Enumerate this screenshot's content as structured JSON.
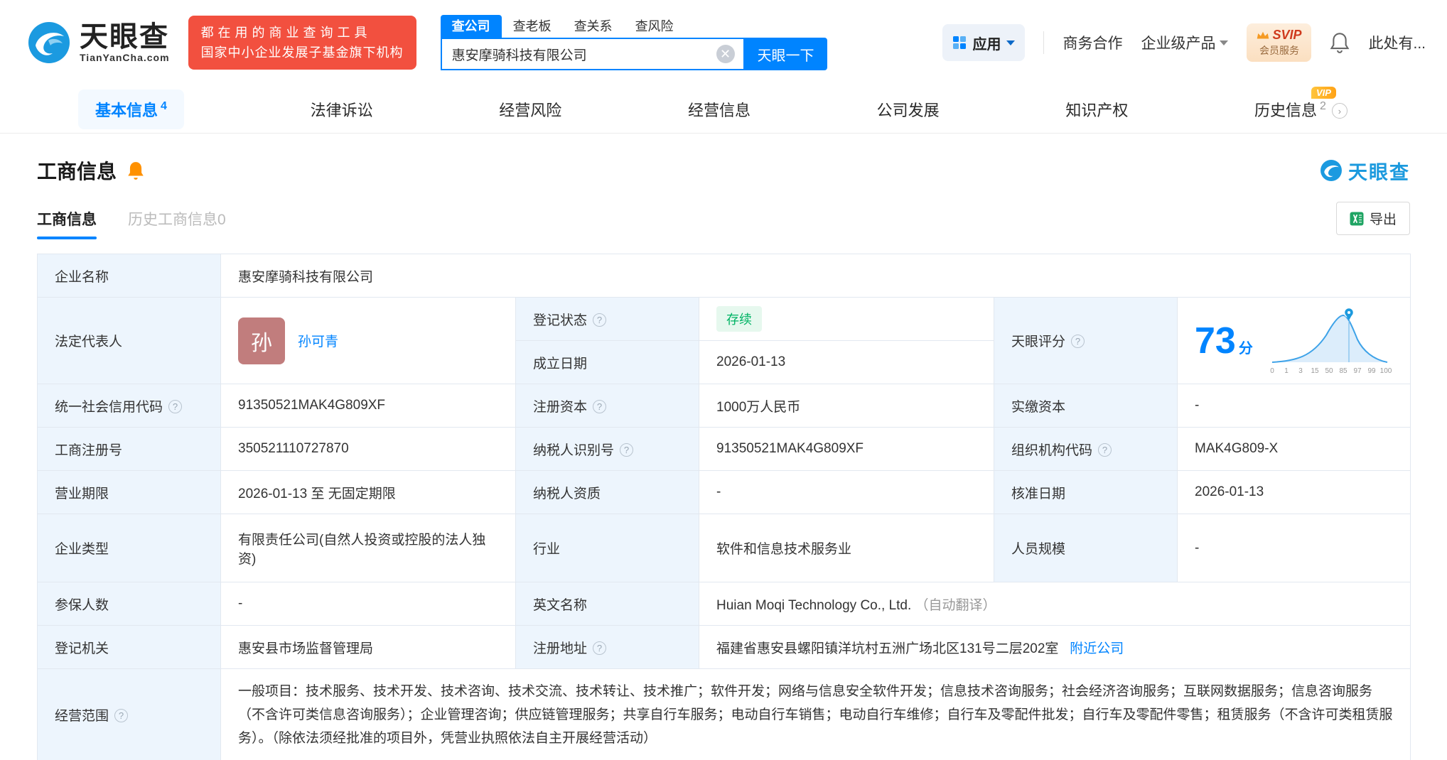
{
  "header": {
    "brand": {
      "name": "天眼查",
      "domain": "TianYanCha.com"
    },
    "promo": {
      "line1": "都在用的商业查询工具",
      "line2": "国家中小企业发展子基金旗下机构"
    },
    "search_tabs": [
      {
        "label": "查公司"
      },
      {
        "label": "查老板"
      },
      {
        "label": "查关系"
      },
      {
        "label": "查风险"
      }
    ],
    "search": {
      "value": "惠安摩骑科技有限公司",
      "button": "天眼一下"
    },
    "apps_label": "应用",
    "cooperation": "商务合作",
    "enterprise": "企业级产品",
    "svip": {
      "title": "SVIP",
      "subtitle": "会员服务"
    },
    "more": "此处有..."
  },
  "nav_tabs": [
    {
      "label": "基本信息",
      "badge": "4"
    },
    {
      "label": "法律诉讼",
      "badge": ""
    },
    {
      "label": "经营风险",
      "badge": ""
    },
    {
      "label": "经营信息",
      "badge": ""
    },
    {
      "label": "公司发展",
      "badge": ""
    },
    {
      "label": "知识产权",
      "badge": ""
    },
    {
      "label": "历史信息",
      "badge": "2",
      "vip": "VIP"
    }
  ],
  "section": {
    "title": "工商信息",
    "logo": "天眼查",
    "subtabs": [
      {
        "label": "工商信息"
      },
      {
        "label": "历史工商信息0"
      }
    ],
    "export_label": "导出"
  },
  "info": {
    "company_name": {
      "label": "企业名称",
      "value": "惠安摩骑科技有限公司"
    },
    "legal_rep": {
      "label": "法定代表人",
      "avatar": "孙",
      "name": "孙可青"
    },
    "reg_status": {
      "label": "登记状态",
      "value": "存续"
    },
    "score": {
      "label": "天眼评分",
      "value": "73",
      "unit": "分",
      "axis": [
        "0",
        "1",
        "3",
        "15",
        "50",
        "85",
        "97",
        "99",
        "100"
      ]
    },
    "establish_date": {
      "label": "成立日期",
      "value": "2026-01-13"
    },
    "credit_code": {
      "label": "统一社会信用代码",
      "value": "91350521MAK4G809XF"
    },
    "reg_capital": {
      "label": "注册资本",
      "value": "1000万人民币"
    },
    "paid_capital": {
      "label": "实缴资本",
      "value": "-"
    },
    "reg_number": {
      "label": "工商注册号",
      "value": "350521110727870"
    },
    "taxpayer_id": {
      "label": "纳税人识别号",
      "value": "91350521MAK4G809XF"
    },
    "org_code": {
      "label": "组织机构代码",
      "value": "MAK4G809-X"
    },
    "business_term": {
      "label": "营业期限",
      "value": "2026-01-13 至 无固定期限"
    },
    "taxpayer_quality": {
      "label": "纳税人资质",
      "value": "-"
    },
    "approval_date": {
      "label": "核准日期",
      "value": "2026-01-13"
    },
    "company_type": {
      "label": "企业类型",
      "value": "有限责任公司(自然人投资或控股的法人独资)"
    },
    "industry": {
      "label": "行业",
      "value": "软件和信息技术服务业"
    },
    "staff_size": {
      "label": "人员规模",
      "value": "-"
    },
    "insured_count": {
      "label": "参保人数",
      "value": "-"
    },
    "english_name": {
      "label": "英文名称",
      "value": "Huian Moqi Technology Co., Ltd.",
      "note": "（自动翻译）"
    },
    "reg_authority": {
      "label": "登记机关",
      "value": "惠安县市场监督管理局"
    },
    "reg_address": {
      "label": "注册地址",
      "value": "福建省惠安县螺阳镇洋坑村五洲广场北区131号二层202室",
      "link": "附近公司"
    },
    "business_scope": {
      "label": "经营范围",
      "value": "一般项目：技术服务、技术开发、技术咨询、技术交流、技术转让、技术推广；软件开发；网络与信息安全软件开发；信息技术咨询服务；社会经济咨询服务；互联网数据服务；信息咨询服务（不含许可类信息咨询服务）；企业管理咨询；供应链管理服务；共享自行车服务；电动自行车销售；电动自行车维修；自行车及零配件批发；自行车及零配件零售；租赁服务（不含许可类租赁服务）。（除依法须经批准的项目外，凭营业执照依法自主开展经营活动）"
    }
  }
}
